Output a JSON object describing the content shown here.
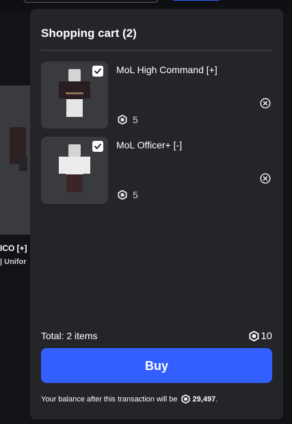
{
  "background": {
    "card_title": "ICO [+]",
    "card_subtitle": "| Unifor"
  },
  "cart": {
    "title": "Shopping cart (2)",
    "items": [
      {
        "name": "MoL High Command [+]",
        "price": "5",
        "checked": true
      },
      {
        "name": "MoL Officer+ [-]",
        "price": "5",
        "checked": true
      }
    ],
    "total_label": "Total: 2 items",
    "total_amount": "10",
    "buy_label": "Buy",
    "balance_prefix": "Your balance after this transaction will be",
    "balance_amount": "29,497",
    "balance_suffix": "."
  },
  "icons": {
    "currency": "robux-icon",
    "checkbox": "checkmark-icon",
    "remove": "close-circle-icon"
  },
  "colors": {
    "accent": "#335fff",
    "panel": "#232529",
    "background": "#121317"
  }
}
